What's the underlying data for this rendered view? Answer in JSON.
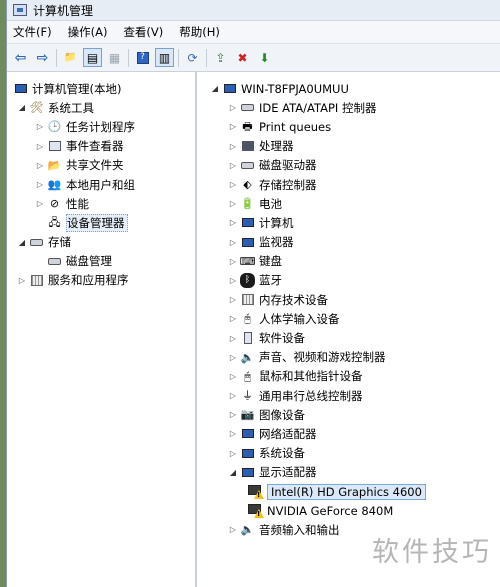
{
  "window": {
    "title": "计算机管理"
  },
  "menu": [
    {
      "label": "文件(F)"
    },
    {
      "label": "操作(A)"
    },
    {
      "label": "查看(V)"
    },
    {
      "label": "帮助(H)"
    }
  ],
  "toolbar": {
    "buttons": [
      {
        "icon": "back-arrow-icon",
        "glyph": "⇦"
      },
      {
        "icon": "forward-arrow-icon",
        "glyph": "⇨"
      },
      {
        "icon": "up-folder-icon",
        "glyph": "📁"
      },
      {
        "icon": "show-hide-tree-icon",
        "glyph": "▤"
      },
      {
        "icon": "properties-icon",
        "glyph": "▦"
      },
      {
        "icon": "help-icon",
        "glyph": "?"
      },
      {
        "icon": "details-view-icon",
        "glyph": "▥"
      },
      {
        "icon": "scan-hardware-icon",
        "glyph": "⟳"
      },
      {
        "icon": "update-driver-icon",
        "glyph": "⇪"
      },
      {
        "icon": "uninstall-icon",
        "glyph": "✖"
      },
      {
        "icon": "enable-device-icon",
        "glyph": "⬇"
      }
    ]
  },
  "tree": {
    "root": "计算机管理(本地)",
    "groups": [
      {
        "label": "系统工具",
        "children": [
          {
            "label": "任务计划程序",
            "icon": "clock-icon"
          },
          {
            "label": "事件查看器",
            "icon": "event-viewer-icon"
          },
          {
            "label": "共享文件夹",
            "icon": "shared-folder-icon"
          },
          {
            "label": "本地用户和组",
            "icon": "users-icon"
          },
          {
            "label": "性能",
            "icon": "performance-icon"
          },
          {
            "label": "设备管理器",
            "icon": "device-manager-icon",
            "selected": true
          }
        ]
      },
      {
        "label": "存储",
        "children": [
          {
            "label": "磁盘管理",
            "icon": "disk-management-icon"
          }
        ]
      },
      {
        "label": "服务和应用程序",
        "children": []
      }
    ]
  },
  "devices": {
    "computer": "WIN-T8FPJA0UMUU",
    "categories": [
      {
        "label": "IDE ATA/ATAPI 控制器",
        "icon": "ide-controller-icon"
      },
      {
        "label": "Print queues",
        "icon": "printer-icon"
      },
      {
        "label": "处理器",
        "icon": "processor-icon"
      },
      {
        "label": "磁盘驱动器",
        "icon": "disk-drive-icon"
      },
      {
        "label": "存储控制器",
        "icon": "storage-controller-icon"
      },
      {
        "label": "电池",
        "icon": "battery-icon"
      },
      {
        "label": "计算机",
        "icon": "computer-icon"
      },
      {
        "label": "监视器",
        "icon": "monitor-icon"
      },
      {
        "label": "键盘",
        "icon": "keyboard-icon"
      },
      {
        "label": "蓝牙",
        "icon": "bluetooth-icon"
      },
      {
        "label": "内存技术设备",
        "icon": "memory-device-icon"
      },
      {
        "label": "人体学输入设备",
        "icon": "hid-icon"
      },
      {
        "label": "软件设备",
        "icon": "software-device-icon"
      },
      {
        "label": "声音、视频和游戏控制器",
        "icon": "sound-icon"
      },
      {
        "label": "鼠标和其他指针设备",
        "icon": "mouse-icon"
      },
      {
        "label": "通用串行总线控制器",
        "icon": "usb-icon"
      },
      {
        "label": "图像设备",
        "icon": "imaging-device-icon"
      },
      {
        "label": "网络适配器",
        "icon": "network-adapter-icon"
      },
      {
        "label": "系统设备",
        "icon": "system-device-icon"
      },
      {
        "label": "显示适配器",
        "icon": "display-adapter-icon",
        "expanded": true,
        "children": [
          {
            "label": "Intel(R) HD Graphics 4600",
            "selected": true
          },
          {
            "label": "NVIDIA GeForce 840M"
          }
        ]
      },
      {
        "label": "音频输入和输出",
        "icon": "audio-io-icon"
      }
    ]
  },
  "watermark": "软件技巧"
}
